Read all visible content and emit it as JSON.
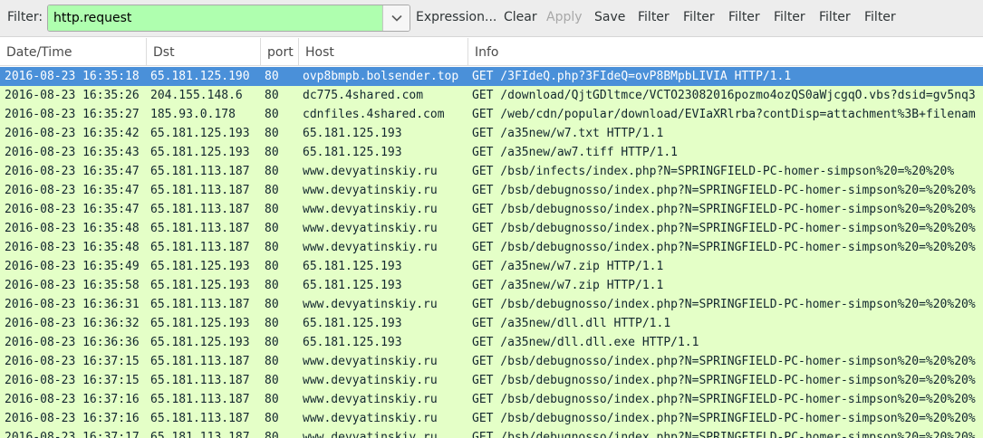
{
  "toolbar": {
    "filter_label": "Filter:",
    "filter_value": "http.request",
    "buttons": [
      {
        "label": "Expression...",
        "enabled": true
      },
      {
        "label": "Clear",
        "enabled": true
      },
      {
        "label": "Apply",
        "enabled": false
      },
      {
        "label": "Save",
        "enabled": true
      },
      {
        "label": "Filter",
        "enabled": true
      },
      {
        "label": "Filter",
        "enabled": true
      },
      {
        "label": "Filter",
        "enabled": true
      },
      {
        "label": "Filter",
        "enabled": true
      },
      {
        "label": "Filter",
        "enabled": true
      },
      {
        "label": "Filter",
        "enabled": true
      }
    ]
  },
  "columns": [
    "Date/Time",
    "Dst",
    "port",
    "Host",
    "Info"
  ],
  "colors": {
    "row_background": "#e4ffc7",
    "selected_background": "#4a90d9",
    "filter_valid_background": "#afffaf"
  },
  "selected_row": 0,
  "rows": [
    {
      "time": "2016-08-23 16:35:18",
      "dst": "65.181.125.190",
      "port": "80",
      "host": "ovp8bmpb.bolsender.top",
      "info": "GET /3FIdeQ.php?3FIdeQ=ovP8BMpbLIVIA HTTP/1.1"
    },
    {
      "time": "2016-08-23 16:35:26",
      "dst": "204.155.148.6",
      "port": "80",
      "host": "dc775.4shared.com",
      "info": "GET /download/QjtGDltmce/VCTO23082016pozmo4ozQS0aWjcgqO.vbs?dsid=gv5nq3"
    },
    {
      "time": "2016-08-23 16:35:27",
      "dst": "185.93.0.178",
      "port": "80",
      "host": "cdnfiles.4shared.com",
      "info": "GET /web/cdn/popular/download/EVIaXRlrba?contDisp=attachment%3B+filenam"
    },
    {
      "time": "2016-08-23 16:35:42",
      "dst": "65.181.125.193",
      "port": "80",
      "host": "65.181.125.193",
      "info": "GET /a35new/w7.txt HTTP/1.1"
    },
    {
      "time": "2016-08-23 16:35:43",
      "dst": "65.181.125.193",
      "port": "80",
      "host": "65.181.125.193",
      "info": "GET /a35new/aw7.tiff HTTP/1.1"
    },
    {
      "time": "2016-08-23 16:35:47",
      "dst": "65.181.113.187",
      "port": "80",
      "host": "www.devyatinskiy.ru",
      "info": "GET /bsb/infects/index.php?N=SPRINGFIELD-PC-homer-simpson%20=%20%20%"
    },
    {
      "time": "2016-08-23 16:35:47",
      "dst": "65.181.113.187",
      "port": "80",
      "host": "www.devyatinskiy.ru",
      "info": "GET /bsb/debugnosso/index.php?N=SPRINGFIELD-PC-homer-simpson%20=%20%20%"
    },
    {
      "time": "2016-08-23 16:35:47",
      "dst": "65.181.113.187",
      "port": "80",
      "host": "www.devyatinskiy.ru",
      "info": "GET /bsb/debugnosso/index.php?N=SPRINGFIELD-PC-homer-simpson%20=%20%20%"
    },
    {
      "time": "2016-08-23 16:35:48",
      "dst": "65.181.113.187",
      "port": "80",
      "host": "www.devyatinskiy.ru",
      "info": "GET /bsb/debugnosso/index.php?N=SPRINGFIELD-PC-homer-simpson%20=%20%20%"
    },
    {
      "time": "2016-08-23 16:35:48",
      "dst": "65.181.113.187",
      "port": "80",
      "host": "www.devyatinskiy.ru",
      "info": "GET /bsb/debugnosso/index.php?N=SPRINGFIELD-PC-homer-simpson%20=%20%20%"
    },
    {
      "time": "2016-08-23 16:35:49",
      "dst": "65.181.125.193",
      "port": "80",
      "host": "65.181.125.193",
      "info": "GET /a35new/w7.zip HTTP/1.1"
    },
    {
      "time": "2016-08-23 16:35:58",
      "dst": "65.181.125.193",
      "port": "80",
      "host": "65.181.125.193",
      "info": "GET /a35new/w7.zip HTTP/1.1"
    },
    {
      "time": "2016-08-23 16:36:31",
      "dst": "65.181.113.187",
      "port": "80",
      "host": "www.devyatinskiy.ru",
      "info": "GET /bsb/debugnosso/index.php?N=SPRINGFIELD-PC-homer-simpson%20=%20%20%"
    },
    {
      "time": "2016-08-23 16:36:32",
      "dst": "65.181.125.193",
      "port": "80",
      "host": "65.181.125.193",
      "info": "GET /a35new/dll.dll HTTP/1.1"
    },
    {
      "time": "2016-08-23 16:36:36",
      "dst": "65.181.125.193",
      "port": "80",
      "host": "65.181.125.193",
      "info": "GET /a35new/dll.dll.exe HTTP/1.1"
    },
    {
      "time": "2016-08-23 16:37:15",
      "dst": "65.181.113.187",
      "port": "80",
      "host": "www.devyatinskiy.ru",
      "info": "GET /bsb/debugnosso/index.php?N=SPRINGFIELD-PC-homer-simpson%20=%20%20%"
    },
    {
      "time": "2016-08-23 16:37:15",
      "dst": "65.181.113.187",
      "port": "80",
      "host": "www.devyatinskiy.ru",
      "info": "GET /bsb/debugnosso/index.php?N=SPRINGFIELD-PC-homer-simpson%20=%20%20%"
    },
    {
      "time": "2016-08-23 16:37:16",
      "dst": "65.181.113.187",
      "port": "80",
      "host": "www.devyatinskiy.ru",
      "info": "GET /bsb/debugnosso/index.php?N=SPRINGFIELD-PC-homer-simpson%20=%20%20%"
    },
    {
      "time": "2016-08-23 16:37:16",
      "dst": "65.181.113.187",
      "port": "80",
      "host": "www.devyatinskiy.ru",
      "info": "GET /bsb/debugnosso/index.php?N=SPRINGFIELD-PC-homer-simpson%20=%20%20%"
    },
    {
      "time": "2016-08-23 16:37:17",
      "dst": "65.181.113.187",
      "port": "80",
      "host": "www.devyatinskiy.ru",
      "info": "GET /bsb/debugnosso/index.php?N=SPRINGFIELD-PC-homer-simpson%20=%20%20%"
    }
  ]
}
